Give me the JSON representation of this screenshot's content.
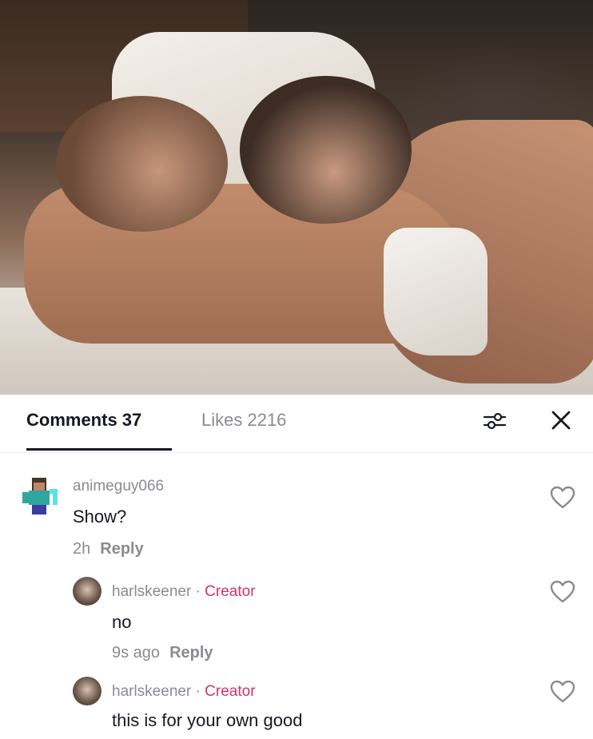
{
  "tabs": {
    "comments_label": "Comments 37",
    "likes_label": "Likes 2216"
  },
  "icons": {
    "filter": "sliders-icon",
    "close": "close-icon",
    "like": "heart-outline-icon"
  },
  "colors": {
    "creator_accent": "#d1336b",
    "muted_text": "#8a8b91",
    "primary_text": "#161823"
  },
  "comments": [
    {
      "username": "animeguy066",
      "text": "Show?",
      "time": "2h",
      "reply_label": "Reply"
    }
  ],
  "replies": [
    {
      "username": "harlskeener",
      "separator": " · ",
      "badge": "Creator",
      "text": "no",
      "time": "9s ago",
      "reply_label": "Reply"
    },
    {
      "username": "harlskeener",
      "separator": " · ",
      "badge": "Creator",
      "text": "this is for your own good"
    }
  ]
}
